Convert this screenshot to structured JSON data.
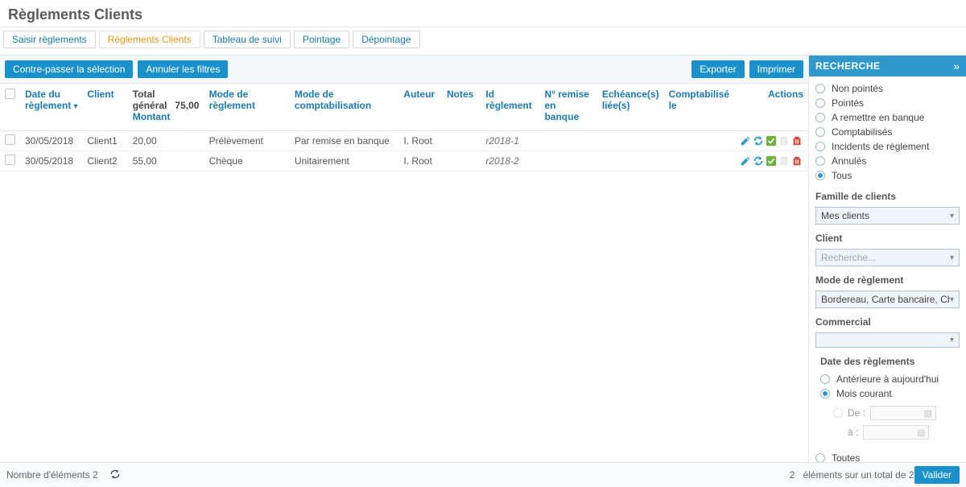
{
  "page_title": "Règlements Clients",
  "tabs": [
    {
      "label": "Saisir règlements",
      "active": false
    },
    {
      "label": "Règlements Clients",
      "active": true
    },
    {
      "label": "Tableau de suivi",
      "active": false
    },
    {
      "label": "Pointage",
      "active": false
    },
    {
      "label": "Dépointage",
      "active": false
    }
  ],
  "toolbar": {
    "contre_passer": "Contre-passer la sélection",
    "annuler_filtres": "Annuler les filtres",
    "exporter": "Exporter",
    "imprimer": "Imprimer"
  },
  "columns": {
    "date": "Date du règlement",
    "client": "Client",
    "general_total": "Total général",
    "montant": "Montant",
    "total_value": "75,00",
    "mode_reglement": "Mode de règlement",
    "mode_compta": "Mode de comptabilisation",
    "auteur": "Auteur",
    "notes": "Notes",
    "id_reglement": "Id règlement",
    "remise": "N° remise en banque",
    "echeances": "Echéance(s) liée(s)",
    "comptabilise": "Comptabilisé le",
    "actions": "Actions"
  },
  "rows": [
    {
      "date": "30/05/2018",
      "client": "Client1",
      "montant": "20,00",
      "mode_reglement": "Prélèvement",
      "mode_compta": "Par remise en banque",
      "auteur": "I. Root",
      "notes": "",
      "id_reglement": "r2018-1",
      "remise": "",
      "echeances": "",
      "comptabilise": ""
    },
    {
      "date": "30/05/2018",
      "client": "Client2",
      "montant": "55,00",
      "mode_reglement": "Chèque",
      "mode_compta": "Unitairement",
      "auteur": "I. Root",
      "notes": "",
      "id_reglement": "r2018-2",
      "remise": "",
      "echeances": "",
      "comptabilise": ""
    }
  ],
  "search": {
    "title": "RECHERCHE",
    "status_options": [
      {
        "label": "Non pointés",
        "checked": false
      },
      {
        "label": "Pointés",
        "checked": false
      },
      {
        "label": "A remettre en banque",
        "checked": false
      },
      {
        "label": "Comptabilisés",
        "checked": false
      },
      {
        "label": "Incidents de règlement",
        "checked": false
      },
      {
        "label": "Annulés",
        "checked": false
      },
      {
        "label": "Tous",
        "checked": true
      }
    ],
    "famille_label": "Famille de clients",
    "famille_value": "Mes clients",
    "client_label": "Client",
    "client_placeholder": "Recherche...",
    "mode_label": "Mode de règlement",
    "mode_value": "Bordereau, Carte bancaire, Chèqu",
    "commercial_label": "Commercial",
    "commercial_value": "",
    "date_label": "Date des règlements",
    "date_options": [
      {
        "label": "Antérieure à aujourd'hui",
        "checked": false,
        "disabled": false
      },
      {
        "label": "Mois courant",
        "checked": true,
        "disabled": false
      }
    ],
    "de_label": "De :",
    "a_label": "à :",
    "toutes_label": "Toutes"
  },
  "status": {
    "count_label": "Nombre d'éléments",
    "count_value": "2",
    "middle_count": "2",
    "middle_text": "éléments sur un total de 2",
    "valider": "Valider"
  }
}
